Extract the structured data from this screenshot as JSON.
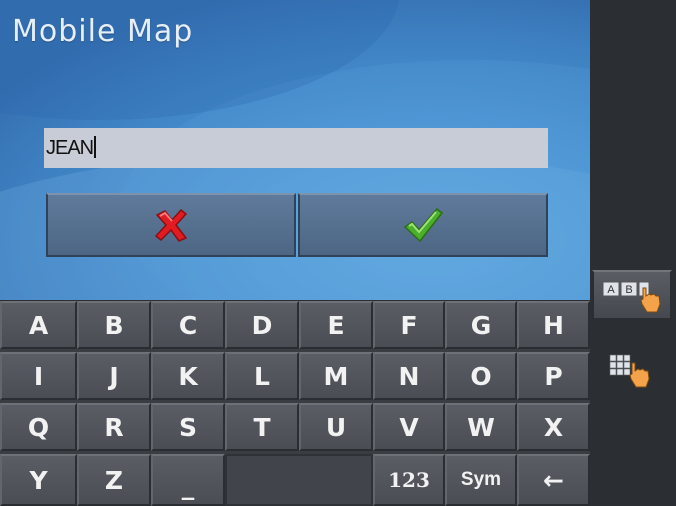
{
  "header": {
    "title": "Mobile  Map"
  },
  "input": {
    "value": "JEAN"
  },
  "actions": {
    "cancel_icon": "red-x-icon",
    "confirm_icon": "green-check-icon"
  },
  "keyboard": {
    "row1": [
      "A",
      "B",
      "C",
      "D",
      "E",
      "F",
      "G",
      "H"
    ],
    "row2": [
      "I",
      "J",
      "K",
      "L",
      "M",
      "N",
      "O",
      "P"
    ],
    "row3": [
      "Q",
      "R",
      "S",
      "T",
      "U",
      "V",
      "W",
      "X"
    ],
    "row4": [
      "Y",
      "Z",
      "_",
      "",
      "123",
      "Sym",
      "←"
    ]
  },
  "side": {
    "alphabet_mode_icon": "ab-keyboard-hand-icon",
    "grid_mode_icon": "grid-keyboard-hand-icon"
  },
  "colors": {
    "cancel": "#e11b22",
    "confirm": "#4caf2a",
    "accent": "#4b95d3"
  }
}
